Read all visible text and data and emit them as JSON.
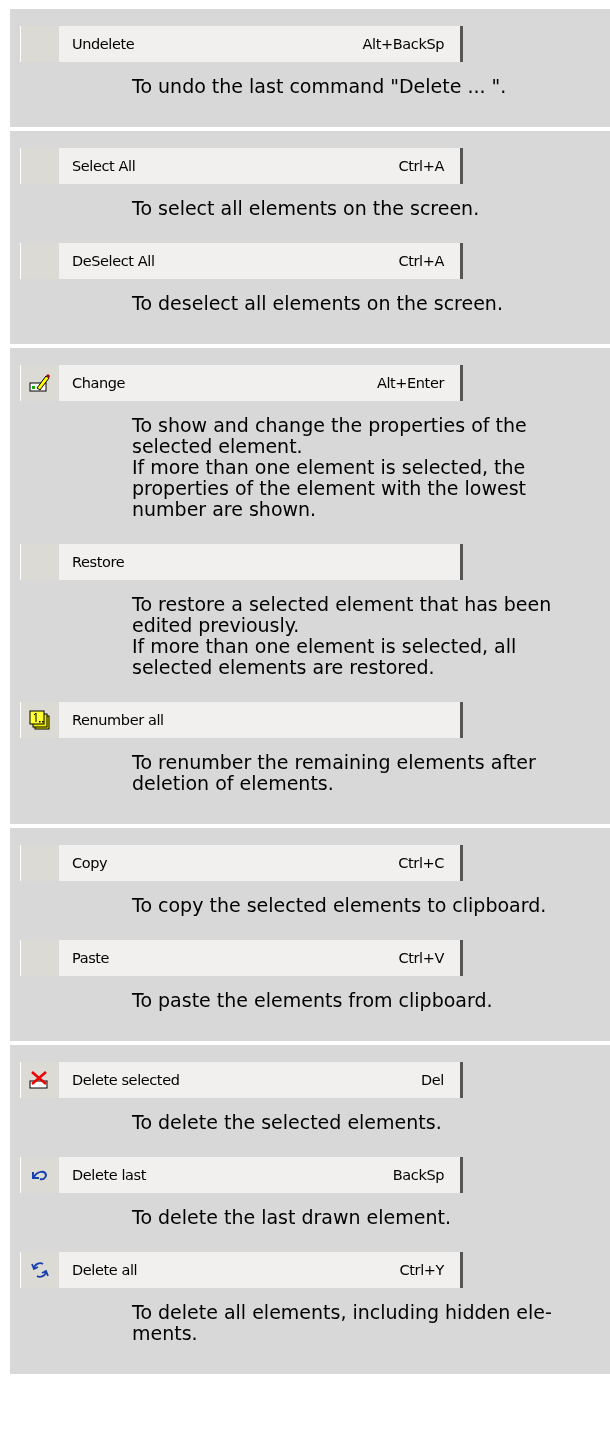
{
  "sections": [
    {
      "items": [
        {
          "kind": "plain",
          "label": "Undelete",
          "shortcut": "Alt+BackSp",
          "description": [
            "To undo the last command \"Delete ... \"."
          ]
        }
      ]
    },
    {
      "items": [
        {
          "kind": "plain",
          "label": "Select All",
          "shortcut": "Ctrl+A",
          "description": [
            "To select all elements on the screen."
          ]
        },
        {
          "kind": "plain",
          "label": "DeSelect All",
          "shortcut": "Ctrl+A",
          "description": [
            "To deselect all elements on the screen."
          ]
        }
      ]
    },
    {
      "items": [
        {
          "kind": "pencil",
          "label": "Change",
          "shortcut": "Alt+Enter",
          "description": [
            "To show and change the properties of the selected element.",
            "If more than one element is selected, the properties of the element with the lowest number are shown."
          ]
        },
        {
          "kind": "plain",
          "label": "Restore",
          "description": [
            "To restore a selected element that has been edited previously.",
            "If more than one element is selected, all selected elements are restored."
          ]
        },
        {
          "kind": "renumber",
          "label": "Renumber all",
          "description": [
            "To renumber the remaining elements after deletion of elements."
          ]
        }
      ]
    },
    {
      "items": [
        {
          "kind": "plain",
          "label": "Copy",
          "shortcut": "Ctrl+C",
          "description": [
            "To copy the selected elements to clipboard."
          ]
        },
        {
          "kind": "plain",
          "label": "Paste",
          "shortcut": "Ctrl+V",
          "description": [
            "To paste the elements from clipboard."
          ]
        }
      ]
    },
    {
      "items": [
        {
          "kind": "delete",
          "label": "Delete selected",
          "shortcut": "Del",
          "description": [
            "To delete the selected elements."
          ]
        },
        {
          "kind": "undo",
          "label": "Delete last",
          "shortcut": "BackSp",
          "description": [
            "To delete the last drawn element."
          ]
        },
        {
          "kind": "arrows",
          "label": "Delete all",
          "shortcut": "Ctrl+Y",
          "description": [
            "To delete all elements, including hidden ele-",
            "ments."
          ]
        }
      ]
    }
  ]
}
